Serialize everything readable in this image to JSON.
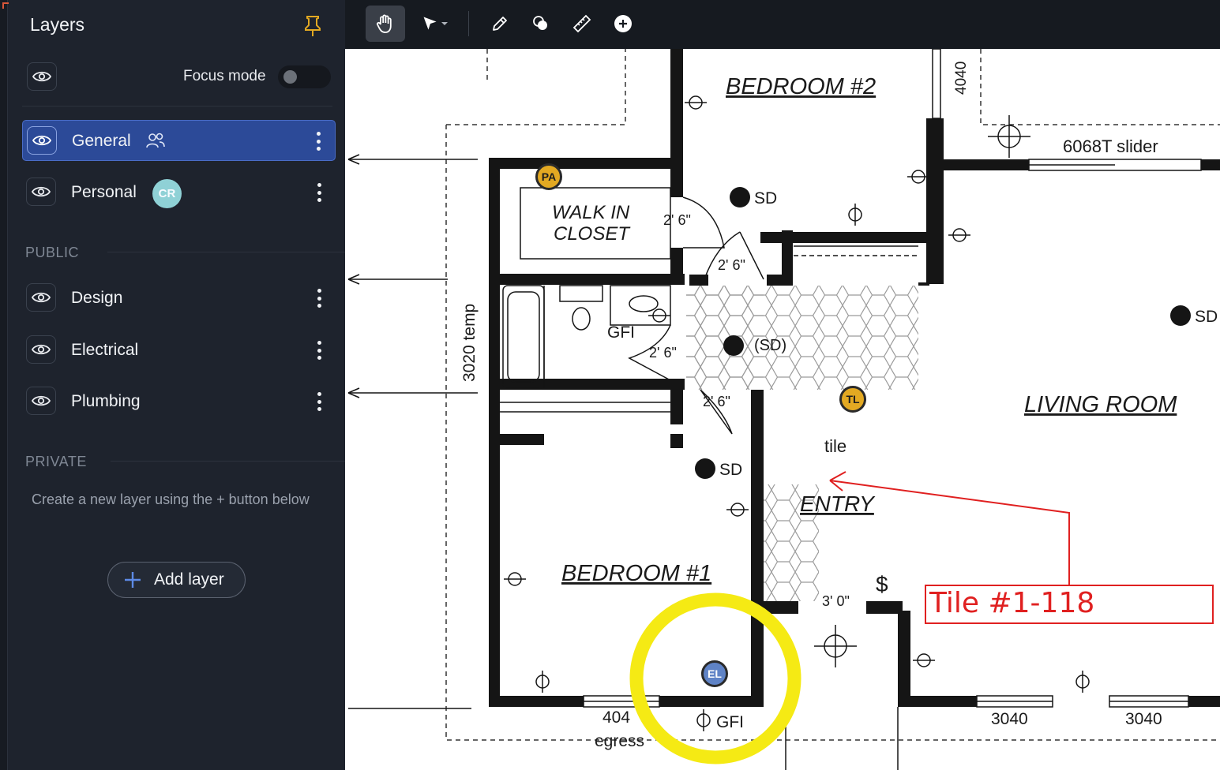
{
  "sidebar": {
    "title": "Layers",
    "focus_mode_label": "Focus mode",
    "focus_mode_on": false,
    "layers": [
      {
        "label": "General",
        "active": true,
        "badge_icon": "people-icon"
      },
      {
        "label": "Personal",
        "active": false,
        "avatar": "CR"
      }
    ],
    "public_heading": "PUBLIC",
    "public_layers": [
      {
        "label": "Design"
      },
      {
        "label": "Electrical"
      },
      {
        "label": "Plumbing"
      }
    ],
    "private_heading": "PRIVATE",
    "private_hint": "Create a new layer using the + button below",
    "add_layer_label": "Add layer"
  },
  "toolbar": {
    "tools": [
      "hand-tool-icon",
      "pointer-tool-icon",
      "pencil-tool-icon",
      "shapes-tool-icon",
      "measure-tool-icon",
      "add-tool-icon"
    ],
    "active_tool": "hand-tool-icon"
  },
  "plan": {
    "labels": {
      "bedroom2": "BEDROOM #2",
      "walkin": "WALK IN",
      "closet": "CLOSET",
      "living": "LIVING ROOM",
      "entry": "ENTRY",
      "bedroom1": "BEDROOM #1",
      "tile": "tile",
      "slider": "6068T slider",
      "temp": "3020 temp",
      "w4040": "4040",
      "sd": "SD",
      "sd_paren": "(SD)",
      "gfi": "GFI",
      "door26": "2' 6\"",
      "door30": "3' 0\"",
      "w3040": "3040",
      "w404": "404",
      "egress": "egress",
      "switch": "$"
    },
    "markers": {
      "pa": "PA",
      "tl": "TL",
      "el": "EL"
    },
    "annotation": "Tile #1-118"
  },
  "colors": {
    "sidebar_bg": "#1e232d",
    "active_layer": "#2c4a98",
    "pin": "#e3a922",
    "annotation_red": "#e02020",
    "highlight_yellow": "#f5ea14"
  }
}
